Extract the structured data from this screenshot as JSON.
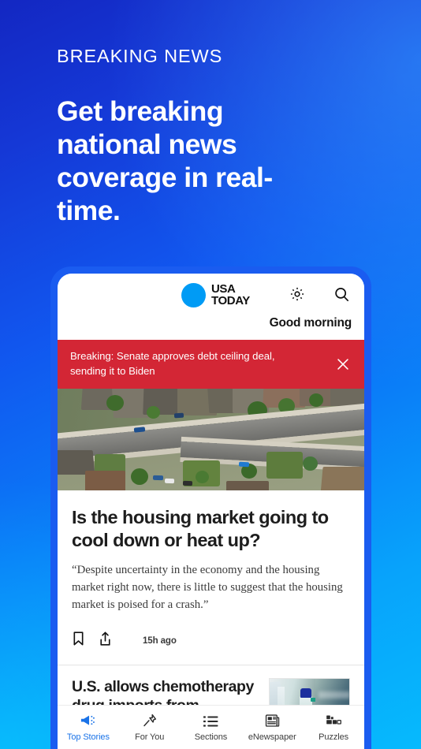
{
  "hero": {
    "eyebrow": "BREAKING NEWS",
    "headline": "Get breaking national news coverage in real-time."
  },
  "colors": {
    "gradient_top": "#1327c2",
    "gradient_bottom": "#06bafd",
    "phone_frame": "#1a5cf0",
    "brand_blue": "#009bf5",
    "breaking_red": "#d32635",
    "active_tab": "#1a73e8"
  },
  "app": {
    "header": {
      "logo_line1": "USA",
      "logo_line2": "TODAY",
      "logo_dot": "usa-today-dot",
      "settings_icon": "gear-icon",
      "search_icon": "search-icon",
      "greeting": "Good morning"
    },
    "banner": {
      "text": "Breaking: Senate approves debt ceiling deal, sending it to Biden",
      "close_icon": "close-icon"
    },
    "articles": [
      {
        "image": "aerial-suburban-neighborhood-photo",
        "title": "Is the housing market going to cool down or heat up?",
        "summary": "“Despite uncertainty in the economy and the housing market right now, there is little to suggest that the housing market is poised for a crash.”",
        "bookmark_icon": "bookmark-icon",
        "share_icon": "share-icon",
        "timestamp": "15h ago"
      },
      {
        "title": "U.S. allows chemotherapy drug imports from",
        "thumbnail": "medical-iv-vial-photo"
      }
    ],
    "tabs": [
      {
        "label": "Top Stories",
        "icon": "megaphone-icon",
        "active": true
      },
      {
        "label": "For You",
        "icon": "pushpin-icon",
        "active": false
      },
      {
        "label": "Sections",
        "icon": "list-icon",
        "active": false
      },
      {
        "label": "eNewspaper",
        "icon": "newspaper-icon",
        "active": false
      },
      {
        "label": "Puzzles",
        "icon": "puzzle-icon",
        "active": false
      }
    ]
  }
}
